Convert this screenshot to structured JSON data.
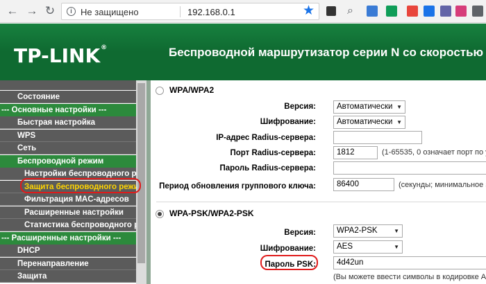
{
  "browser": {
    "security_text": "Не защищено",
    "url": "192.168.0.1",
    "extension_colors": [
      "#4285f4",
      "#f4b400",
      "#3a7bd5",
      "#0f9d58",
      "#e8453c",
      "#1a73e8",
      "#6264a7",
      "#d63d7a",
      "#5f6368"
    ]
  },
  "banner": {
    "logo": "TP-LINK",
    "logo_tm": "®",
    "title": "Беспроводной маршрутизатор серии N со скоростью пе"
  },
  "sidebar": {
    "items": [
      {
        "label": "Состояние"
      },
      {
        "label": "--- Основные настройки ---"
      },
      {
        "label": "Быстрая настройка"
      },
      {
        "label": "WPS"
      },
      {
        "label": "Сеть"
      },
      {
        "label": "Беспроводной режим"
      },
      {
        "label": "Настройки беспроводного реж"
      },
      {
        "label": "Защита беспроводного режим"
      },
      {
        "label": "Фильтрация MAC-адресов"
      },
      {
        "label": "Расширенные настройки"
      },
      {
        "label": "Статистика беспроводного ре"
      },
      {
        "label": "--- Расширенные настройки ---"
      },
      {
        "label": "DHCP"
      },
      {
        "label": "Перенаправление"
      },
      {
        "label": "Защита"
      }
    ]
  },
  "wpa": {
    "title": "WPA/WPA2",
    "version_label": "Версия:",
    "version_value": "Автоматически",
    "encryption_label": "Шифрование:",
    "encryption_value": "Автоматически",
    "radius_ip_label": "IP-адрес Radius-сервера:",
    "radius_ip_value": "",
    "radius_port_label": "Порт Radius-сервера:",
    "radius_port_value": "1812",
    "radius_port_hint": "(1-65535, 0 означает порт по у",
    "radius_pass_label": "Пароль Radius-сервера:",
    "radius_pass_value": "",
    "group_key_label": "Период обновления группового ключа:",
    "group_key_value": "86400",
    "group_key_hint": "(секунды; минимальное зн"
  },
  "wpapsk": {
    "title": "WPA-PSK/WPA2-PSK",
    "version_label": "Версия:",
    "version_value": "WPA2-PSK",
    "encryption_label": "Шифрование:",
    "encryption_value": "AES",
    "psk_label": "Пароль PSK:",
    "psk_value": "4d42un",
    "psk_hint": "(Вы можете ввести символы в кодировке ASC"
  },
  "colors": {
    "banner_green": "#0f6a31",
    "sidebar_green": "#2c8a3c",
    "sidebar_gray": "#5b5b5b",
    "highlight_red": "#e01a1a",
    "active_item": "#ffd400"
  }
}
